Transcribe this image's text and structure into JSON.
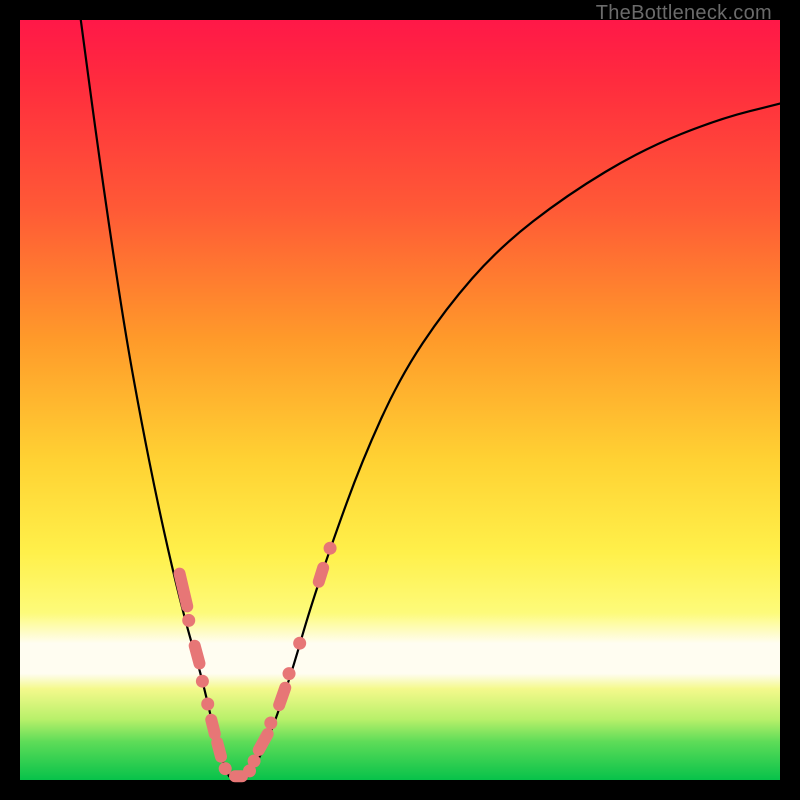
{
  "watermark": "TheBottleneck.com",
  "colors": {
    "gradient_top": "#ff1848",
    "gradient_mid": "#ffd233",
    "gradient_pale": "#fffdf1",
    "gradient_bottom": "#07c24a",
    "curve": "#000000",
    "marker": "#e77676",
    "frame": "#000000"
  },
  "chart_data": {
    "type": "line",
    "title": "",
    "xlabel": "",
    "ylabel": "",
    "xlim": [
      0,
      100
    ],
    "ylim": [
      0,
      100
    ],
    "series": [
      {
        "name": "left-curve",
        "x": [
          8,
          10,
          12,
          14,
          16,
          18,
          20,
          22,
          23.5,
          24.5,
          25.3,
          26,
          26.5,
          27,
          27.5
        ],
        "y": [
          100,
          85,
          71,
          58,
          47,
          37,
          28,
          20,
          15,
          11,
          7.5,
          5,
          3,
          1.6,
          0.5
        ]
      },
      {
        "name": "right-curve",
        "x": [
          30,
          31,
          32.5,
          34,
          36,
          38,
          41,
          45,
          50,
          56,
          63,
          72,
          82,
          92,
          100
        ],
        "y": [
          0.5,
          2,
          5,
          9,
          15,
          22,
          31,
          42,
          53,
          62,
          70,
          77,
          83,
          87,
          89
        ]
      }
    ],
    "markers_left": [
      {
        "x": 21.5,
        "y": 25,
        "kind": "pill",
        "len": 6
      },
      {
        "x": 22.2,
        "y": 21,
        "kind": "dot"
      },
      {
        "x": 23.3,
        "y": 16.5,
        "kind": "pill",
        "len": 4
      },
      {
        "x": 24.0,
        "y": 13,
        "kind": "dot"
      },
      {
        "x": 24.7,
        "y": 10,
        "kind": "dot"
      },
      {
        "x": 25.4,
        "y": 7,
        "kind": "pill",
        "len": 3.5
      },
      {
        "x": 26.2,
        "y": 4,
        "kind": "pill",
        "len": 3.5
      },
      {
        "x": 27.0,
        "y": 1.5,
        "kind": "dot"
      }
    ],
    "markers_right": [
      {
        "x": 30.2,
        "y": 1.2,
        "kind": "dot"
      },
      {
        "x": 30.8,
        "y": 2.5,
        "kind": "dot"
      },
      {
        "x": 32.0,
        "y": 5,
        "kind": "pill",
        "len": 4
      },
      {
        "x": 33.0,
        "y": 7.5,
        "kind": "dot"
      },
      {
        "x": 34.5,
        "y": 11,
        "kind": "pill",
        "len": 4
      },
      {
        "x": 35.4,
        "y": 14,
        "kind": "dot"
      },
      {
        "x": 36.8,
        "y": 18,
        "kind": "dot"
      },
      {
        "x": 39.6,
        "y": 27,
        "kind": "pill",
        "len": 3.5
      },
      {
        "x": 40.8,
        "y": 30.5,
        "kind": "dot"
      }
    ],
    "markers_bottom_bar": {
      "x0": 27.5,
      "x1": 30.0,
      "y": 0.5
    }
  }
}
